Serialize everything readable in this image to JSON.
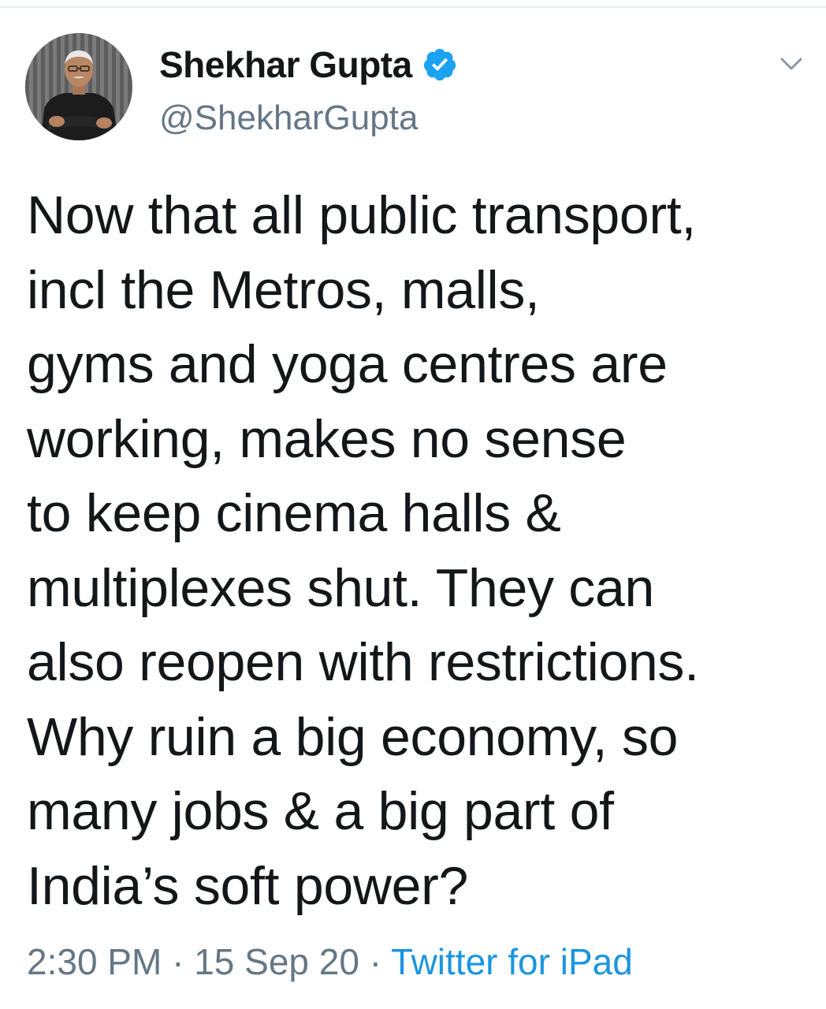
{
  "tweet": {
    "author": {
      "name": "Shekhar Gupta",
      "handle": "@ShekharGupta",
      "verified": true
    },
    "text_lines": [
      "Now that all public transport,",
      "incl the Metros, malls,",
      "gyms and yoga centres are",
      "working, makes no sense",
      "to keep cinema halls &",
      "multiplexes shut. They can",
      "also reopen with restrictions.",
      "Why ruin a big economy, so",
      "many jobs & a big part of",
      "India’s soft power?"
    ],
    "time": "2:30 PM",
    "date": "15 Sep 20",
    "separator": "·",
    "source": "Twitter for iPad"
  },
  "icons": {
    "verified": "verified-badge-icon",
    "more": "chevron-down-icon"
  },
  "colors": {
    "text": "#14171a",
    "secondary": "#657786",
    "link": "#1b95e0",
    "verified": "#1da1f2"
  }
}
